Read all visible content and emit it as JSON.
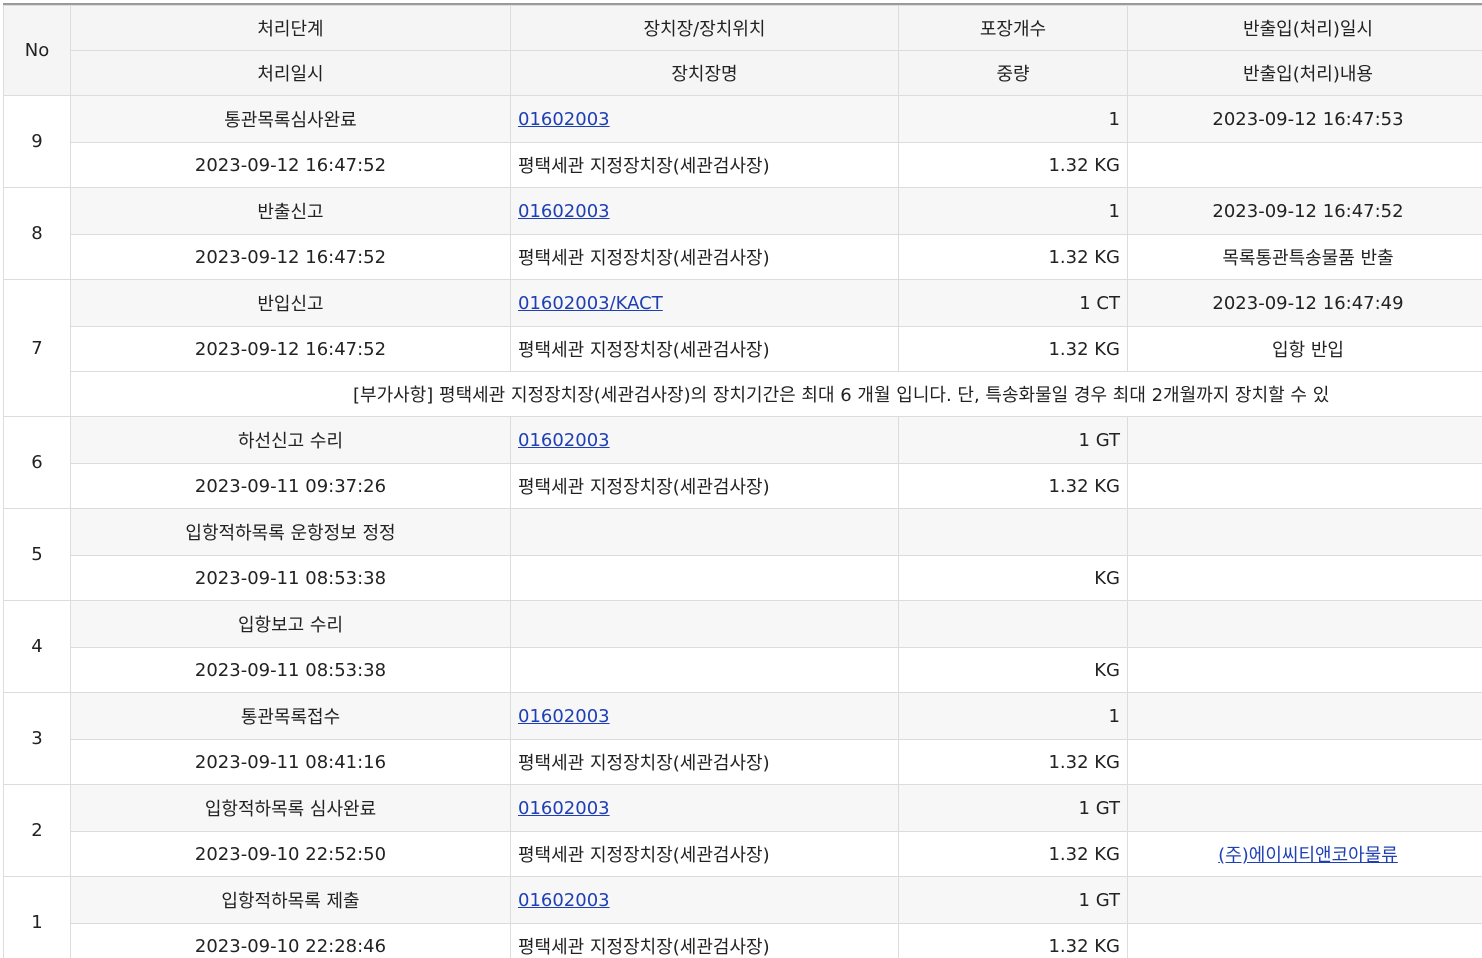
{
  "headers": {
    "no": "No",
    "top": [
      "처리단계",
      "장치장/장치위치",
      "포장개수",
      "반출입(처리)일시"
    ],
    "bottom": [
      "처리일시",
      "장치장명",
      "중량",
      "반출입(처리)내용"
    ]
  },
  "rows": [
    {
      "no": "9",
      "step": "통관목록심사완료",
      "loc": "01602003",
      "pkg": "1",
      "io_time": "2023-09-12 16:47:53",
      "time": "2023-09-12 16:47:52",
      "loc_name": "평택세관 지정장치장(세관검사장)",
      "weight": "1.32 KG",
      "io_content": ""
    },
    {
      "no": "8",
      "step": "반출신고",
      "loc": "01602003",
      "pkg": "1",
      "io_time": "2023-09-12 16:47:52",
      "time": "2023-09-12 16:47:52",
      "loc_name": "평택세관 지정장치장(세관검사장)",
      "weight": "1.32 KG",
      "io_content": "목록통관특송물품 반출"
    },
    {
      "no": "7",
      "step": "반입신고",
      "loc": "01602003/KACT",
      "pkg": "1 CT",
      "io_time": "2023-09-12 16:47:49",
      "time": "2023-09-12 16:47:52",
      "loc_name": "평택세관 지정장치장(세관검사장)",
      "weight": "1.32 KG",
      "io_content": "입항 반입",
      "note": "[부가사항] 평택세관 지정장치장(세관검사장)의 장치기간은 최대 6 개월 입니다. 단, 특송화물일 경우 최대 2개월까지 장치할 수 있"
    },
    {
      "no": "6",
      "step": "하선신고 수리",
      "loc": "01602003",
      "pkg": "1 GT",
      "io_time": "",
      "time": "2023-09-11 09:37:26",
      "loc_name": "평택세관 지정장치장(세관검사장)",
      "weight": "1.32 KG",
      "io_content": ""
    },
    {
      "no": "5",
      "step": "입항적하목록 운항정보 정정",
      "loc": "",
      "pkg": "",
      "io_time": "",
      "time": "2023-09-11 08:53:38",
      "loc_name": "",
      "weight": "KG",
      "io_content": ""
    },
    {
      "no": "4",
      "step": "입항보고 수리",
      "loc": "",
      "pkg": "",
      "io_time": "",
      "time": "2023-09-11 08:53:38",
      "loc_name": "",
      "weight": "KG",
      "io_content": ""
    },
    {
      "no": "3",
      "step": "통관목록접수",
      "loc": "01602003",
      "pkg": "1",
      "io_time": "",
      "time": "2023-09-11 08:41:16",
      "loc_name": "평택세관 지정장치장(세관검사장)",
      "weight": "1.32 KG",
      "io_content": ""
    },
    {
      "no": "2",
      "step": "입항적하목록 심사완료",
      "loc": "01602003",
      "pkg": "1 GT",
      "io_time": "",
      "time": "2023-09-10 22:52:50",
      "loc_name": "평택세관 지정장치장(세관검사장)",
      "weight": "1.32 KG",
      "io_content": "(주)에이씨티앤코아물류",
      "io_content_link": true
    },
    {
      "no": "1",
      "step": "입항적하목록 제출",
      "loc": "01602003",
      "pkg": "1 GT",
      "io_time": "",
      "time": "2023-09-10 22:28:46",
      "loc_name": "평택세관 지정장치장(세관검사장)",
      "weight": "1.32 KG",
      "io_content": ""
    }
  ],
  "colors": {
    "link": "#1f3fb5",
    "header_bg": "#f5f5f5",
    "border": "#dcdcdc"
  }
}
